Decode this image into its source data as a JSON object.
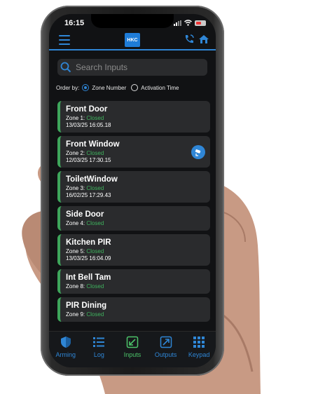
{
  "status": {
    "time": "16:15"
  },
  "header": {
    "logo": "HKC"
  },
  "search": {
    "placeholder": "Search Inputs"
  },
  "order": {
    "label": "Order by:",
    "options": [
      {
        "label": "Zone Number",
        "selected": true
      },
      {
        "label": "Activation Time",
        "selected": false
      }
    ]
  },
  "inputs": [
    {
      "name": "Front Door",
      "zone": "Zone 1:",
      "status": "Closed",
      "time": "13/03/25 16:05.18"
    },
    {
      "name": "Front Window",
      "zone": "Zone 2:",
      "status": "Closed",
      "time": "12/03/25 17:30.15",
      "bypass_icon": "bypass-camera-icon"
    },
    {
      "name": "ToiletWindow",
      "zone": "Zone 3:",
      "status": "Closed",
      "time": "16/02/25 17:29.43"
    },
    {
      "name": "Side Door",
      "zone": "Zone 4:",
      "status": "Closed"
    },
    {
      "name": "Kitchen PIR",
      "zone": "Zone 5:",
      "status": "Closed",
      "time": "13/03/25 16:04.09"
    },
    {
      "name": "Int Bell Tam",
      "zone": "Zone 8:",
      "status": "Closed"
    },
    {
      "name": "PIR Dining",
      "zone": "Zone 9:",
      "status": "Closed"
    }
  ],
  "nav": {
    "items": [
      {
        "label": "Arming",
        "icon": "shield-icon"
      },
      {
        "label": "Log",
        "icon": "list-icon"
      },
      {
        "label": "Inputs",
        "icon": "input-arrow-icon",
        "active": true
      },
      {
        "label": "Outputs",
        "icon": "output-arrow-icon"
      },
      {
        "label": "Keypad",
        "icon": "keypad-icon"
      }
    ]
  },
  "colors": {
    "accent": "#2f86d6",
    "closed": "#3fb35e",
    "card": "#2a2b2d",
    "background": "#111214"
  }
}
